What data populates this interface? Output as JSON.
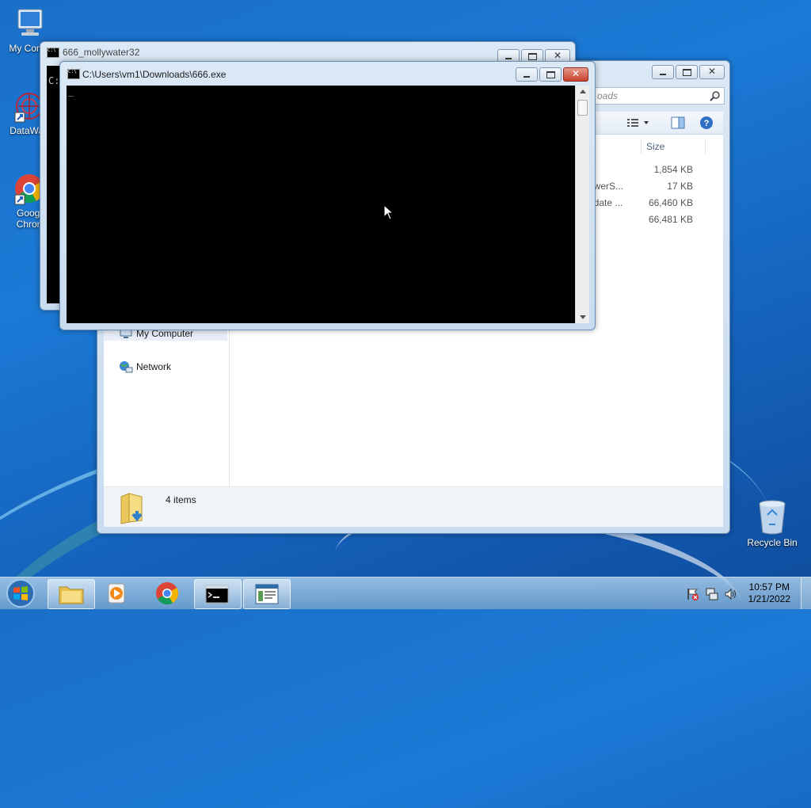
{
  "desktop": {
    "icons": [
      {
        "label": "My Comp",
        "icon": "computer-icon"
      },
      {
        "label": "DataWag",
        "icon": "datawag-icon"
      },
      {
        "label": "Googl",
        "label2": "Chron",
        "icon": "chrome-icon"
      },
      {
        "label": "Recycle Bin",
        "icon": "recycle-bin-icon"
      }
    ]
  },
  "window_back_cmd": {
    "title": "666_mollywater32",
    "console_text": "C:"
  },
  "window_cmd": {
    "title": "C:\\Users\\vm1\\Downloads\\666.exe",
    "cursor": "_"
  },
  "window_explorer": {
    "search_placeholder": "oads",
    "column_size": "Size",
    "rows": [
      {
        "name": "",
        "size": "1,854 KB"
      },
      {
        "name": "owerS...",
        "size": "17 KB"
      },
      {
        "name": "pdate ...",
        "size": "66,460 KB"
      },
      {
        "name": "",
        "size": "66,481 KB"
      }
    ],
    "nav": {
      "my_computer": "My Computer",
      "network": "Network"
    },
    "status": "4 items"
  },
  "taskbar": {
    "items": [
      "start-button",
      "explorer",
      "media-player",
      "chrome",
      "cmd",
      "app"
    ],
    "time": "10:57 PM",
    "date": "1/21/2022"
  },
  "colors": {
    "close_red": "#c8412d",
    "console_bg": "#000000",
    "desktop_blue": "#1a6fc8"
  }
}
